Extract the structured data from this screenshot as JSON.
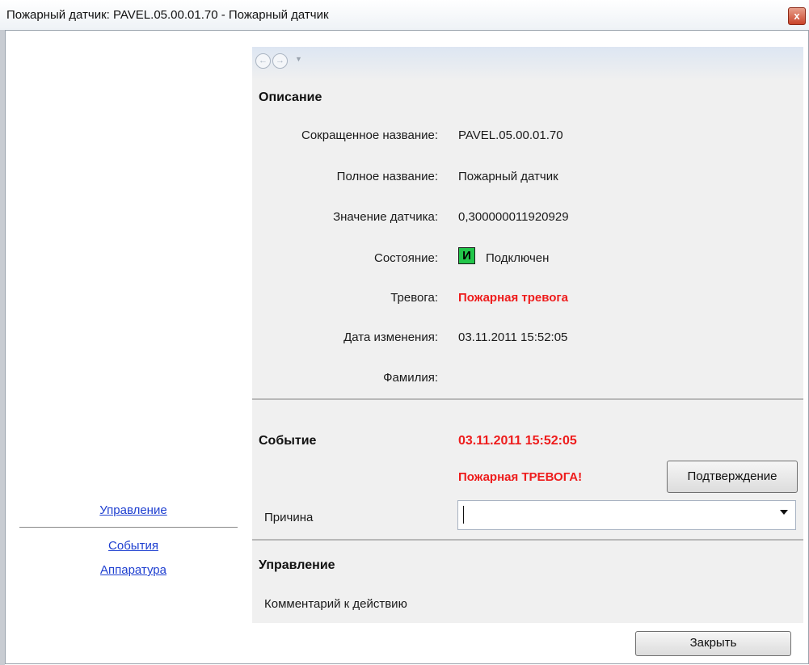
{
  "window": {
    "title": "Пожарный датчик: PAVEL.05.00.01.70 - Пожарный датчик",
    "close_glyph": "x"
  },
  "sidebar": {
    "links": [
      "Управление",
      "События",
      "Аппаратура"
    ]
  },
  "nav": {
    "back_icon": "back-arrow-icon",
    "forward_icon": "forward-arrow-icon"
  },
  "description": {
    "header": "Описание",
    "rows": [
      {
        "label": "Сокращенное название:",
        "value": "PAVEL.05.00.01.70"
      },
      {
        "label": "Полное название:",
        "value": "Пожарный датчик"
      },
      {
        "label": "Значение датчика:",
        "value": "0,300000011920929"
      },
      {
        "label": "Состояние:",
        "value": "Подключен",
        "icon_letter": "И"
      },
      {
        "label": "Тревога:",
        "value": "Пожарная тревога"
      },
      {
        "label": "Дата изменения:",
        "value": "03.11.2011 15:52:05"
      },
      {
        "label": "Фамилия:",
        "value": ""
      }
    ]
  },
  "event": {
    "header": "Событие",
    "datetime": "03.11.2011 15:52:05",
    "message": "Пожарная ТРЕВОГА!",
    "confirm_button": "Подтверждение",
    "reason_label": "Причина",
    "reason_value": ""
  },
  "control": {
    "header": "Управление",
    "comment_label": "Комментарий к действию"
  },
  "footer": {
    "close_button": "Закрыть"
  },
  "colors": {
    "alarm_red": "#ee1c1c",
    "status_green": "#22c64a",
    "link_blue": "#1e3fd0"
  }
}
